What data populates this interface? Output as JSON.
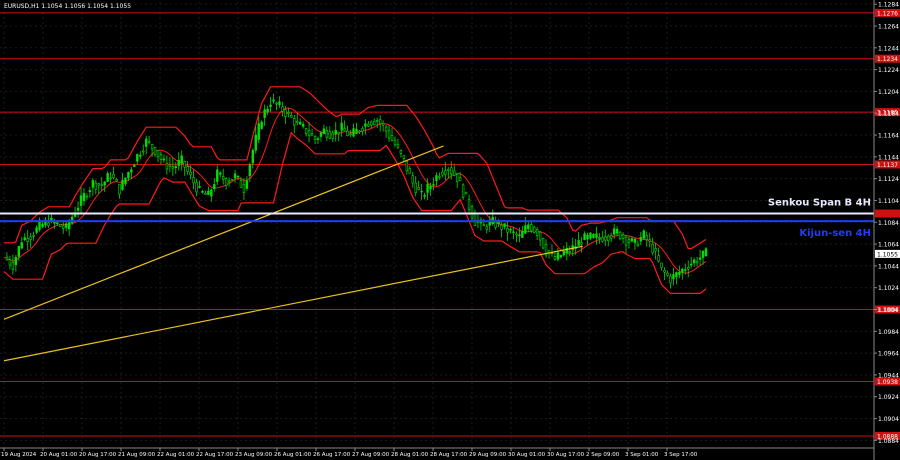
{
  "header": {
    "symbol_line": "EURUSD,H1  1.1054 1.1056 1.1054 1.1055"
  },
  "colors": {
    "background": "#000000",
    "candle": "#00e000",
    "level_line": "#d01010",
    "trend_line": "#e8c020",
    "ichimoku_band": "#ff1a1a",
    "senkou_span_b": "#e8e8ff",
    "kijun_sen": "#1e3cff",
    "label_bg": "#d01010",
    "current_price_bg": "#ffffff",
    "axis_text": "#ffffff"
  },
  "chart_data": {
    "type": "candlestick",
    "symbol": "EURUSD",
    "timeframe": "H1",
    "y_axis": {
      "ylim": [
        1.0877,
        1.1286
      ],
      "ticks": [
        "1.1284",
        "1.1264",
        "1.1244",
        "1.1224",
        "1.1204",
        "1.1184",
        "1.1164",
        "1.1144",
        "1.1124",
        "1.1104",
        "1.1084",
        "1.1064",
        "1.1044",
        "1.1024",
        "1.1004",
        "1.0984",
        "1.0964",
        "1.0944",
        "1.0924",
        "1.0904",
        "1.0884"
      ]
    },
    "x_axis": {
      "ticks": [
        "19 Aug 2024",
        "20 Aug 01:00",
        "20 Aug 17:00",
        "21 Aug 09:00",
        "22 Aug 01:00",
        "22 Aug 17:00",
        "23 Aug 09:00",
        "26 Aug 01:00",
        "26 Aug 17:00",
        "27 Aug 09:00",
        "28 Aug 01:00",
        "28 Aug 17:00",
        "29 Aug 09:00",
        "30 Aug 01:00",
        "30 Aug 17:00",
        "2 Sep 09:00",
        "3 Sep 01:00",
        "3 Sep 17:00"
      ]
    },
    "close_path": [
      [
        0,
        1.1052
      ],
      [
        3,
        1.1045
      ],
      [
        6,
        1.1068
      ],
      [
        9,
        1.1072
      ],
      [
        12,
        1.108
      ],
      [
        15,
        1.1085
      ],
      [
        18,
        1.1082
      ],
      [
        21,
        1.1078
      ],
      [
        24,
        1.1095
      ],
      [
        27,
        1.1108
      ],
      [
        30,
        1.112
      ],
      [
        33,
        1.1118
      ],
      [
        36,
        1.1128
      ],
      [
        39,
        1.1114
      ],
      [
        42,
        1.113
      ],
      [
        45,
        1.1145
      ],
      [
        48,
        1.1158
      ],
      [
        51,
        1.115
      ],
      [
        54,
        1.1138
      ],
      [
        57,
        1.1134
      ],
      [
        60,
        1.114
      ],
      [
        63,
        1.1125
      ],
      [
        66,
        1.1112
      ],
      [
        69,
        1.1108
      ],
      [
        72,
        1.1128
      ],
      [
        75,
        1.1122
      ],
      [
        78,
        1.1126
      ],
      [
        81,
        1.1115
      ],
      [
        84,
        1.115
      ],
      [
        87,
        1.118
      ],
      [
        90,
        1.1195
      ],
      [
        93,
        1.119
      ],
      [
        96,
        1.1182
      ],
      [
        99,
        1.1174
      ],
      [
        102,
        1.1168
      ],
      [
        105,
        1.116
      ],
      [
        108,
        1.1168
      ],
      [
        111,
        1.1165
      ],
      [
        114,
        1.117
      ],
      [
        117,
        1.1163
      ],
      [
        120,
        1.117
      ],
      [
        123,
        1.1176
      ],
      [
        126,
        1.1178
      ],
      [
        129,
        1.1168
      ],
      [
        132,
        1.1155
      ],
      [
        135,
        1.114
      ],
      [
        138,
        1.112
      ],
      [
        141,
        1.1108
      ],
      [
        144,
        1.1118
      ],
      [
        147,
        1.113
      ],
      [
        150,
        1.1134
      ],
      [
        153,
        1.1125
      ],
      [
        156,
        1.1105
      ],
      [
        159,
        1.1085
      ],
      [
        162,
        1.108
      ],
      [
        165,
        1.1084
      ],
      [
        168,
        1.108
      ],
      [
        171,
        1.1075
      ],
      [
        174,
        1.107
      ],
      [
        177,
        1.1082
      ],
      [
        180,
        1.1075
      ],
      [
        183,
        1.1058
      ],
      [
        186,
        1.105
      ],
      [
        189,
        1.1056
      ],
      [
        192,
        1.106
      ],
      [
        195,
        1.1068
      ],
      [
        198,
        1.107
      ],
      [
        201,
        1.107
      ],
      [
        204,
        1.1072
      ],
      [
        207,
        1.1075
      ],
      [
        210,
        1.1068
      ],
      [
        213,
        1.1064
      ],
      [
        216,
        1.1072
      ],
      [
        219,
        1.106
      ],
      [
        222,
        1.104
      ],
      [
        225,
        1.1032
      ],
      [
        228,
        1.1038
      ],
      [
        231,
        1.1045
      ],
      [
        234,
        1.105
      ],
      [
        237,
        1.1055
      ]
    ],
    "bands": {
      "upper_offset": 0.0022,
      "lower_offset": 0.0022,
      "middle_offset": 0.0
    },
    "horizontal_levels": [
      {
        "price": 1.1276,
        "label": "1.1276",
        "color": "#d01010"
      },
      {
        "price": 1.1234,
        "label": "1.1234",
        "color": "#d01010"
      },
      {
        "price": 1.1185,
        "label": "1.1185",
        "color": "#d01010"
      },
      {
        "price": 1.1137,
        "label": "1.1137",
        "color": "#d01010"
      },
      {
        "price": 1.1004,
        "label": "1.1004",
        "color": "#d01010"
      },
      {
        "price": 1.0938,
        "label": "1.0938",
        "color": "#d01010"
      },
      {
        "price": 1.0888,
        "label": "1.0888",
        "color": "#d01010"
      }
    ],
    "indicator_lines": [
      {
        "name": "Senkou Span B 4H",
        "price": 1.1092,
        "color": "#e8e8ff"
      },
      {
        "name": "Kijun-sen 4H",
        "price": 1.1085,
        "color": "#1e3cff"
      }
    ],
    "trend_lines": [
      {
        "from": [
          0,
          1.0995
        ],
        "to": [
          145,
          1.1154
        ]
      },
      {
        "from": [
          0,
          1.0957
        ],
        "to": [
          192,
          1.1062
        ]
      }
    ],
    "current_price": "1.1055",
    "senkou_label": "Senkou Span B 4H",
    "kijun_label": "Kijun-sen 4H",
    "grid": true
  }
}
